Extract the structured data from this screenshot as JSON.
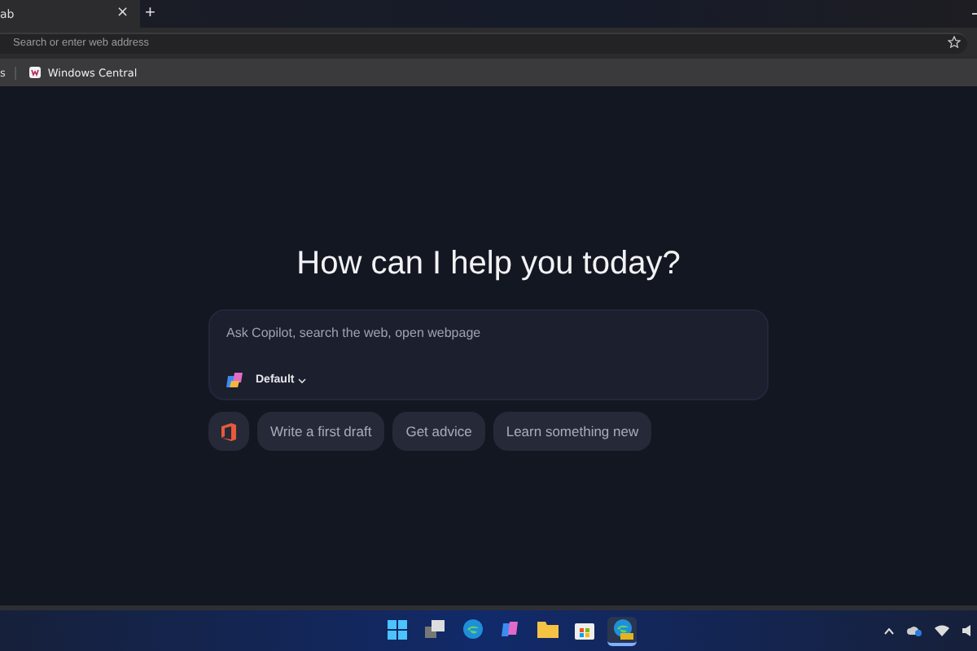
{
  "tabs": [
    {
      "label": "ab",
      "selected": true,
      "close": "×"
    }
  ],
  "new_tab": "+",
  "address_bar": {
    "placeholder": "Search or enter web address"
  },
  "bookmarks": [
    {
      "label": "s",
      "kind": "text"
    },
    {
      "label": "Windows Central",
      "kind": "site"
    }
  ],
  "copilot": {
    "heading": "How can I help you today?",
    "prompt": {
      "placeholder": "Ask Copilot, search the web, open webpage"
    },
    "mode": "Default",
    "suggestions": [
      "Write a first draft",
      "Get advice",
      "Learn something new"
    ]
  },
  "taskbar": {
    "apps": [
      {
        "kind": "start",
        "selected": false
      },
      {
        "kind": "taskview",
        "selected": false
      },
      {
        "kind": "edge",
        "selected": false
      },
      {
        "kind": "copilot",
        "selected": false
      },
      {
        "kind": "files",
        "selected": false
      },
      {
        "kind": "store",
        "selected": false
      },
      {
        "kind": "edgecan",
        "selected": true
      }
    ]
  }
}
